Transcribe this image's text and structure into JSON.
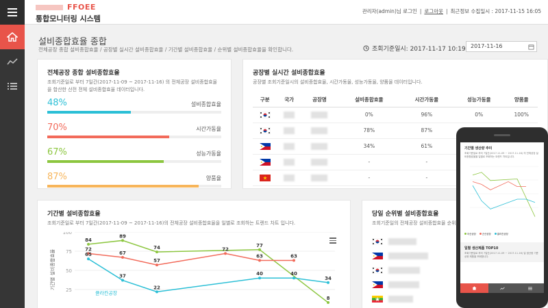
{
  "app": {
    "logo_text": "FFOEE",
    "system_title": "통합모니터링 시스템",
    "user_info": "관리자(admin)님 로그인",
    "logout_label": "로그아웃",
    "last_update": "최근정보 수집일시 : 2017-11-15 16:05"
  },
  "sidebar": {
    "items": [
      {
        "icon": "home-icon",
        "active": true
      },
      {
        "icon": "trend-chart-icon",
        "active": false
      },
      {
        "icon": "list-icon",
        "active": false
      }
    ]
  },
  "header": {
    "title": "설비종합효율 종합",
    "description": "전체공장 종합 설비종합효율 / 공장별 실시간 설비종합효율 / 기간별 설비종합효율 / 순위별 설비종합효율을 확인합니다.",
    "std_time_label": "조회기준일시: 2017-11-17 10:19",
    "date_value": "2017-11-16"
  },
  "overall": {
    "title": "전체공장 종합 설비종합효율",
    "desc": "조회기준일로 부터 7일간(2017-11-09 ~ 2017-11-16) 의 전체공장 설비종합효율을 합산한 산전 전체 설비종합효율 데이터입니다.",
    "kpis": [
      {
        "value": "48%",
        "label": "설비종합효율",
        "color": "#2bbfd6",
        "fraction": 0.48
      },
      {
        "value": "70%",
        "label": "시간가동율",
        "color": "#f26a5a",
        "fraction": 0.7
      },
      {
        "value": "67%",
        "label": "성능가동율",
        "color": "#8cc63f",
        "fraction": 0.67
      },
      {
        "value": "87%",
        "label": "양품율",
        "color": "#f7b55a",
        "fraction": 0.87
      }
    ]
  },
  "factory": {
    "title": "공장별 실시간 설비종합효율",
    "desc": "공장별 조회기준일시의 설비종합효율, 시간가동율, 성능가동율, 양품율 데이터입니다.",
    "columns": [
      "구분",
      "국가",
      "공장명",
      "설비종합효율",
      "시간가동율",
      "성능가동율",
      "양품율"
    ],
    "rows": [
      {
        "flag": "KR",
        "oee": "0%",
        "time": "96%",
        "perf": "0%",
        "quality": "100%"
      },
      {
        "flag": "KR",
        "oee": "78%",
        "time": "87%",
        "perf": "",
        "quality": ""
      },
      {
        "flag": "PH",
        "oee": "34%",
        "time": "61%",
        "perf": "",
        "quality": ""
      },
      {
        "flag": "PH",
        "oee": "-",
        "time": "-",
        "perf": "",
        "quality": ""
      },
      {
        "flag": "VN",
        "oee": "-",
        "time": "-",
        "perf": "",
        "quality": ""
      }
    ]
  },
  "period": {
    "title": "기간별 설비종합효율",
    "desc": "조회기준일로 부터 7일간(2017-11-09 ~ 2017-11-16)의 전체공장 설비종합효율을 일별로 조회하는 트렌드 차트 입니다.",
    "ylabel": "기간별 설비종합효율",
    "ticks": [
      "100",
      "75",
      "50",
      "25"
    ]
  },
  "chart_data": {
    "type": "line",
    "ylim": [
      0,
      100
    ],
    "ylabel": "기간별 설비종합효율",
    "grid": true,
    "series": [
      {
        "name": "",
        "color": "#8cc63f",
        "values": [
          84,
          89,
          74,
          null,
          null,
          77,
          null,
          8
        ]
      },
      {
        "name": "",
        "color": "#f26a5a",
        "values": [
          72,
          67,
          57,
          null,
          72,
          63,
          63,
          null
        ]
      },
      {
        "name": "",
        "color": "#2bbfd6",
        "values": [
          65,
          37,
          22,
          null,
          null,
          40,
          40,
          34
        ]
      }
    ],
    "labels_shown": [
      "84",
      "89",
      "74",
      "77",
      "8",
      "72",
      "67",
      "57",
      "72",
      "63",
      "63",
      "65",
      "37",
      "40",
      "40",
      "34"
    ],
    "annotation": "클라칸공장"
  },
  "ranking": {
    "title": "당일 순위별 설비종합효율",
    "desc": "조회기준일의 전체공장 설비종합효율 순위별로 조회합니다.",
    "flags": [
      "KR",
      "PH",
      "KR",
      "PH",
      "MM"
    ]
  },
  "phone": {
    "card1_title": "기간별 생산량 추이",
    "card1_desc": "조회기준일로 부터 7일간(2017-11-09 ~ 2017-11-16) 의 전체공장 설비종합효율을 일별로 조회하는 트렌드 차트입니다.",
    "card2_title": "일별 생산제품 TOP10",
    "card2_desc": "조회기준일로 부터 7일간(2017-11-09 ~ 2017-11-16) 일 생산량 기준 상위 제품을 조회합니다.",
    "legend": [
      "아산공장",
      "군산공장",
      "클라칸공장"
    ]
  }
}
